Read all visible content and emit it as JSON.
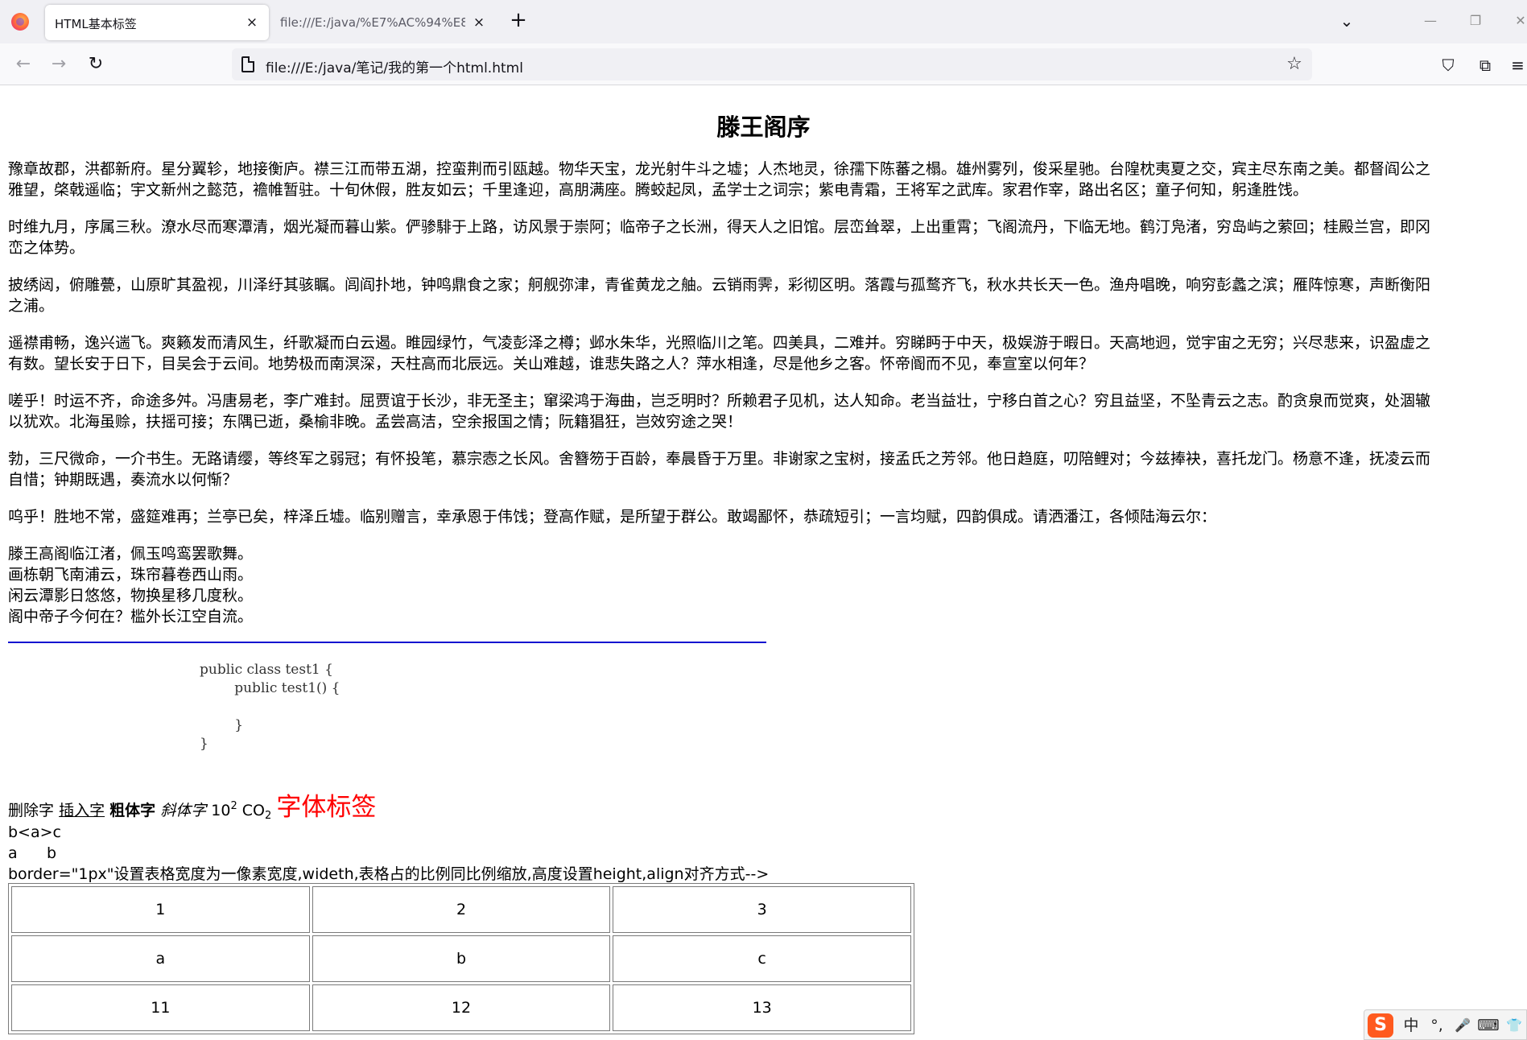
{
  "browser": {
    "tabs": [
      {
        "title": "HTML基本标签",
        "active": true
      },
      {
        "title": "file:///E:/java/%E7%AC%94%E8%",
        "active": false
      }
    ],
    "icons": {
      "close_tab": "×",
      "new_tab": "+",
      "list_all_tabs": "⌄",
      "minimize": "—",
      "maximize": "❐",
      "window_close": "✕",
      "back": "←",
      "forward": "→",
      "reload": "↻",
      "bookmark": "☆",
      "pocket": "⛉",
      "extensions": "⧉",
      "menu": "≡"
    },
    "url": "file:///E:/java/笔记/我的第一个html.html"
  },
  "page": {
    "title": "滕王阁序",
    "paragraphs": [
      [
        "豫章故郡，洪都新府。星分翼轸，地接衡庐。襟三江而带五湖，控蛮荆而引瓯越。物华天宝，龙光射牛斗之墟；人杰地灵，徐孺下陈蕃之榻。雄州雾列，俊采星驰。台隍枕夷夏之交，宾主尽东南之美。都督阎公之",
        "雅望，棨戟遥临；宇文新州之懿范，襜帷暂驻。十旬休假，胜友如云；千里逢迎，高朋满座。腾蛟起凤，孟学士之词宗；紫电青霜，王将军之武库。家君作宰，路出名区；童子何知，躬逢胜饯。"
      ],
      [
        "时维九月，序属三秋。潦水尽而寒潭清，烟光凝而暮山紫。俨骖騑于上路，访风景于崇阿；临帝子之长洲，得天人之旧馆。层峦耸翠，上出重霄；飞阁流丹，下临无地。鹤汀凫渚，穷岛屿之萦回；桂殿兰宫，即冈",
        "峦之体势。"
      ],
      [
        "披绣闼，俯雕甍，山原旷其盈视，川泽纡其骇瞩。闾阎扑地，钟鸣鼎食之家；舸舰弥津，青雀黄龙之舳。云销雨霁，彩彻区明。落霞与孤鹜齐飞，秋水共长天一色。渔舟唱晚，响穷彭蠡之滨；雁阵惊寒，声断衡阳",
        "之浦。"
      ],
      [
        "遥襟甫畅，逸兴遄飞。爽籁发而清风生，纤歌凝而白云遏。睢园绿竹，气凌彭泽之樽；邺水朱华，光照临川之笔。四美具，二难并。穷睇眄于中天，极娱游于暇日。天高地迥，觉宇宙之无穷；兴尽悲来，识盈虚之",
        "有数。望长安于日下，目吴会于云间。地势极而南溟深，天柱高而北辰远。关山难越，谁悲失路之人？萍水相逢，尽是他乡之客。怀帝阍而不见，奉宣室以何年？"
      ],
      [
        "嗟乎！时运不齐，命途多舛。冯唐易老，李广难封。屈贾谊于长沙，非无圣主；窜梁鸿于海曲，岂乏明时？所赖君子见机，达人知命。老当益壮，宁移白首之心？穷且益坚，不坠青云之志。酌贪泉而觉爽，处涸辙",
        "以犹欢。北海虽赊，扶摇可接；东隅已逝，桑榆非晚。孟尝高洁，空余报国之情；阮籍猖狂，岂效穷途之哭！"
      ],
      [
        "勃，三尺微命，一介书生。无路请缨，等终军之弱冠；有怀投笔，慕宗悫之长风。舍簪笏于百龄，奉晨昏于万里。非谢家之宝树，接孟氏之芳邻。他日趋庭，叨陪鲤对；今兹捧袂，喜托龙门。杨意不逢，抚凌云而",
        "自惜；钟期既遇，奏流水以何惭？"
      ],
      [
        "呜乎！胜地不常，盛筵难再；兰亭已矣，梓泽丘墟。临别赠言，幸承恩于伟饯；登高作赋，是所望于群公。敢竭鄙怀，恭疏短引；一言均赋，四韵俱成。请洒潘江，各倾陆海云尔："
      ]
    ],
    "verses": [
      "滕王高阁临江渚，佩玉鸣鸾罢歌舞。",
      "画栋朝飞南浦云，珠帘暮卷西山雨。",
      "闲云潭影日悠悠，物换星移几度秋。",
      "阁中帝子今何在？槛外长江空自流。"
    ],
    "code_lines": [
      "public class test1 {",
      "        public test1() {",
      "",
      "        }",
      "}"
    ],
    "inline": {
      "deleted": "删除字",
      "inserted": "插入字",
      "bold": "粗体字",
      "italic": "斜体字",
      "sup_base": "10",
      "sup": "2",
      "sub_base": "CO",
      "sub": "2",
      "font_tag": "字体标签",
      "font_tag_color": "#ff0000"
    },
    "escaped_line": "b<a>c",
    "space_line": [
      "a",
      "b"
    ],
    "note_line": "border=\"1px\"设置表格宽度为一像素宽度,wideth,表格占的比例同比例缩放,高度设置height,align对齐方式-->",
    "table": [
      [
        "1",
        "2",
        "3"
      ],
      [
        "a",
        "b",
        "c"
      ],
      [
        "11",
        "12",
        "13"
      ]
    ],
    "hr_color": "#1010d0"
  },
  "ime": {
    "logo": "S",
    "mode": "中",
    "punct": "°,",
    "mic_icon": "🎤",
    "keyboard_icon": "⌨",
    "skin_icon": "👕"
  }
}
